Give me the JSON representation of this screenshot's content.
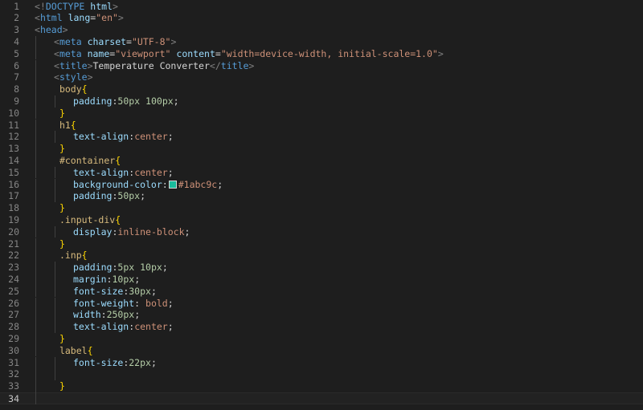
{
  "editor": {
    "language": "html",
    "current_line": 34,
    "lines": [
      {
        "n": "1",
        "indent": 0,
        "tokens": [
          {
            "t": "punct",
            "v": "<!"
          },
          {
            "t": "doctype",
            "v": "DOCTYPE"
          },
          {
            "t": "plain",
            "v": " "
          },
          {
            "t": "attr",
            "v": "html"
          },
          {
            "t": "punct",
            "v": ">"
          }
        ]
      },
      {
        "n": "2",
        "indent": 0,
        "tokens": [
          {
            "t": "punct",
            "v": "<"
          },
          {
            "t": "tag",
            "v": "html"
          },
          {
            "t": "plain",
            "v": " "
          },
          {
            "t": "attr",
            "v": "lang"
          },
          {
            "t": "plain",
            "v": "="
          },
          {
            "t": "str",
            "v": "\"en\""
          },
          {
            "t": "punct",
            "v": ">"
          }
        ]
      },
      {
        "n": "3",
        "indent": 0,
        "tokens": [
          {
            "t": "punct",
            "v": "<"
          },
          {
            "t": "tag",
            "v": "head"
          },
          {
            "t": "punct",
            "v": ">"
          }
        ]
      },
      {
        "n": "4",
        "indent": 1,
        "tokens": [
          {
            "t": "punct",
            "v": "<"
          },
          {
            "t": "tag",
            "v": "meta"
          },
          {
            "t": "plain",
            "v": " "
          },
          {
            "t": "attr",
            "v": "charset"
          },
          {
            "t": "plain",
            "v": "="
          },
          {
            "t": "str",
            "v": "\"UTF-8\""
          },
          {
            "t": "punct",
            "v": ">"
          }
        ]
      },
      {
        "n": "5",
        "indent": 1,
        "tokens": [
          {
            "t": "punct",
            "v": "<"
          },
          {
            "t": "tag",
            "v": "meta"
          },
          {
            "t": "plain",
            "v": " "
          },
          {
            "t": "attr",
            "v": "name"
          },
          {
            "t": "plain",
            "v": "="
          },
          {
            "t": "str",
            "v": "\"viewport\""
          },
          {
            "t": "plain",
            "v": " "
          },
          {
            "t": "attr",
            "v": "content"
          },
          {
            "t": "plain",
            "v": "="
          },
          {
            "t": "str",
            "v": "\"width=device-width, initial-scale=1.0\""
          },
          {
            "t": "punct",
            "v": ">"
          }
        ]
      },
      {
        "n": "6",
        "indent": 1,
        "tokens": [
          {
            "t": "punct",
            "v": "<"
          },
          {
            "t": "tag",
            "v": "title"
          },
          {
            "t": "punct",
            "v": ">"
          },
          {
            "t": "text",
            "v": "Temperature Converter"
          },
          {
            "t": "punct",
            "v": "</"
          },
          {
            "t": "tag",
            "v": "title"
          },
          {
            "t": "punct",
            "v": ">"
          }
        ]
      },
      {
        "n": "7",
        "indent": 1,
        "tokens": [
          {
            "t": "punct",
            "v": "<"
          },
          {
            "t": "tag",
            "v": "style"
          },
          {
            "t": "punct",
            "v": ">"
          }
        ]
      },
      {
        "n": "8",
        "indent": 1,
        "tokens": [
          {
            "t": "plain",
            "v": " "
          },
          {
            "t": "sel",
            "v": "body"
          },
          {
            "t": "brace",
            "v": "{"
          }
        ]
      },
      {
        "n": "9",
        "indent": 2,
        "tokens": [
          {
            "t": "prop",
            "v": "padding"
          },
          {
            "t": "plain",
            "v": ":"
          },
          {
            "t": "num",
            "v": "50px"
          },
          {
            "t": "plain",
            "v": " "
          },
          {
            "t": "num",
            "v": "100px"
          },
          {
            "t": "plain",
            "v": ";"
          }
        ]
      },
      {
        "n": "10",
        "indent": 1,
        "tokens": [
          {
            "t": "plain",
            "v": " "
          },
          {
            "t": "brace",
            "v": "}"
          }
        ]
      },
      {
        "n": "11",
        "indent": 1,
        "tokens": [
          {
            "t": "plain",
            "v": " "
          },
          {
            "t": "sel",
            "v": "h1"
          },
          {
            "t": "brace",
            "v": "{"
          }
        ]
      },
      {
        "n": "12",
        "indent": 2,
        "tokens": [
          {
            "t": "prop",
            "v": "text-align"
          },
          {
            "t": "plain",
            "v": ":"
          },
          {
            "t": "val",
            "v": "center"
          },
          {
            "t": "plain",
            "v": ";"
          }
        ]
      },
      {
        "n": "13",
        "indent": 1,
        "tokens": [
          {
            "t": "plain",
            "v": " "
          },
          {
            "t": "brace",
            "v": "}"
          }
        ]
      },
      {
        "n": "14",
        "indent": 1,
        "tokens": [
          {
            "t": "plain",
            "v": " "
          },
          {
            "t": "sel",
            "v": "#container"
          },
          {
            "t": "brace",
            "v": "{"
          }
        ]
      },
      {
        "n": "15",
        "indent": 2,
        "tokens": [
          {
            "t": "prop",
            "v": "text-align"
          },
          {
            "t": "plain",
            "v": ":"
          },
          {
            "t": "val",
            "v": "center"
          },
          {
            "t": "plain",
            "v": ";"
          }
        ]
      },
      {
        "n": "16",
        "indent": 2,
        "tokens": [
          {
            "t": "prop",
            "v": "background-color"
          },
          {
            "t": "plain",
            "v": ":"
          },
          {
            "t": "swatch",
            "v": "#1abc9c"
          },
          {
            "t": "val",
            "v": "#1abc9c"
          },
          {
            "t": "plain",
            "v": ";"
          }
        ]
      },
      {
        "n": "17",
        "indent": 2,
        "tokens": [
          {
            "t": "prop",
            "v": "padding"
          },
          {
            "t": "plain",
            "v": ":"
          },
          {
            "t": "num",
            "v": "50px"
          },
          {
            "t": "plain",
            "v": ";"
          }
        ]
      },
      {
        "n": "18",
        "indent": 1,
        "tokens": [
          {
            "t": "plain",
            "v": " "
          },
          {
            "t": "brace",
            "v": "}"
          }
        ]
      },
      {
        "n": "19",
        "indent": 1,
        "tokens": [
          {
            "t": "plain",
            "v": " "
          },
          {
            "t": "sel",
            "v": ".input-div"
          },
          {
            "t": "brace",
            "v": "{"
          }
        ]
      },
      {
        "n": "20",
        "indent": 2,
        "tokens": [
          {
            "t": "prop",
            "v": "display"
          },
          {
            "t": "plain",
            "v": ":"
          },
          {
            "t": "val",
            "v": "inline-block"
          },
          {
            "t": "plain",
            "v": ";"
          }
        ]
      },
      {
        "n": "21",
        "indent": 1,
        "tokens": [
          {
            "t": "plain",
            "v": " "
          },
          {
            "t": "brace",
            "v": "}"
          }
        ]
      },
      {
        "n": "22",
        "indent": 1,
        "tokens": [
          {
            "t": "plain",
            "v": " "
          },
          {
            "t": "sel",
            "v": ".inp"
          },
          {
            "t": "brace",
            "v": "{"
          }
        ]
      },
      {
        "n": "23",
        "indent": 2,
        "tokens": [
          {
            "t": "prop",
            "v": "padding"
          },
          {
            "t": "plain",
            "v": ":"
          },
          {
            "t": "num",
            "v": "5px"
          },
          {
            "t": "plain",
            "v": " "
          },
          {
            "t": "num",
            "v": "10px"
          },
          {
            "t": "plain",
            "v": ";"
          }
        ]
      },
      {
        "n": "24",
        "indent": 2,
        "tokens": [
          {
            "t": "prop",
            "v": "margin"
          },
          {
            "t": "plain",
            "v": ":"
          },
          {
            "t": "num",
            "v": "10px"
          },
          {
            "t": "plain",
            "v": ";"
          }
        ]
      },
      {
        "n": "25",
        "indent": 2,
        "tokens": [
          {
            "t": "prop",
            "v": "font-size"
          },
          {
            "t": "plain",
            "v": ":"
          },
          {
            "t": "num",
            "v": "30px"
          },
          {
            "t": "plain",
            "v": ";"
          }
        ]
      },
      {
        "n": "26",
        "indent": 2,
        "tokens": [
          {
            "t": "prop",
            "v": "font-weight"
          },
          {
            "t": "plain",
            "v": ": "
          },
          {
            "t": "val",
            "v": "bold"
          },
          {
            "t": "plain",
            "v": ";"
          }
        ]
      },
      {
        "n": "27",
        "indent": 2,
        "tokens": [
          {
            "t": "prop",
            "v": "width"
          },
          {
            "t": "plain",
            "v": ":"
          },
          {
            "t": "num",
            "v": "250px"
          },
          {
            "t": "plain",
            "v": ";"
          }
        ]
      },
      {
        "n": "28",
        "indent": 2,
        "tokens": [
          {
            "t": "prop",
            "v": "text-align"
          },
          {
            "t": "plain",
            "v": ":"
          },
          {
            "t": "val",
            "v": "center"
          },
          {
            "t": "plain",
            "v": ";"
          }
        ]
      },
      {
        "n": "29",
        "indent": 1,
        "tokens": [
          {
            "t": "plain",
            "v": " "
          },
          {
            "t": "brace",
            "v": "}"
          }
        ]
      },
      {
        "n": "30",
        "indent": 1,
        "tokens": [
          {
            "t": "plain",
            "v": " "
          },
          {
            "t": "sel",
            "v": "label"
          },
          {
            "t": "brace",
            "v": "{"
          }
        ]
      },
      {
        "n": "31",
        "indent": 2,
        "tokens": [
          {
            "t": "prop",
            "v": "font-size"
          },
          {
            "t": "plain",
            "v": ":"
          },
          {
            "t": "num",
            "v": "22px"
          },
          {
            "t": "plain",
            "v": ";"
          }
        ]
      },
      {
        "n": "32",
        "indent": 2,
        "tokens": []
      },
      {
        "n": "33",
        "indent": 1,
        "tokens": [
          {
            "t": "plain",
            "v": " "
          },
          {
            "t": "brace",
            "v": "}"
          }
        ]
      },
      {
        "n": "34",
        "indent": 1,
        "tokens": []
      }
    ]
  }
}
